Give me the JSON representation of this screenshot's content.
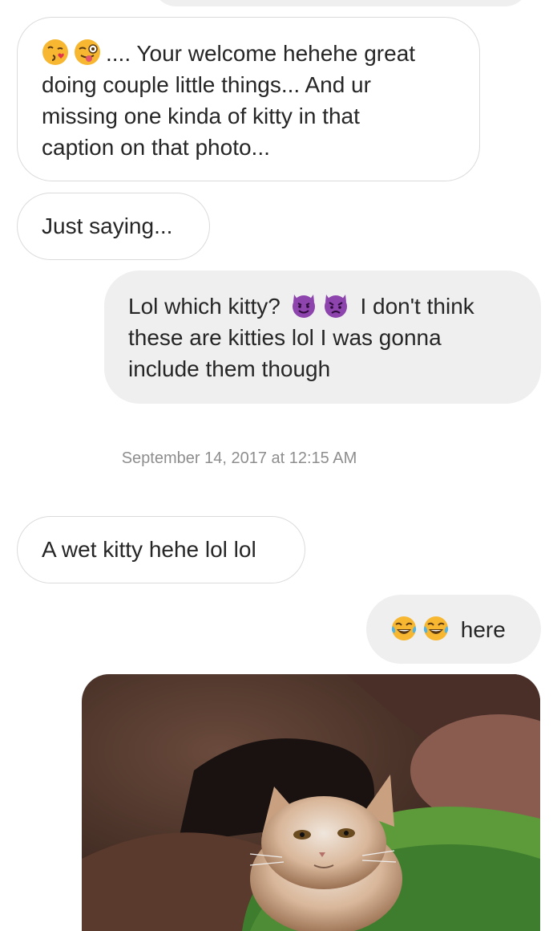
{
  "messages": {
    "msg1": {
      "emojis": [
        "kissing-wink-icon",
        "winking-tongue-icon"
      ],
      "line1": ".... Your welcome hehehe great",
      "line2": "doing couple little things... And ur",
      "line3": "missing one kinda of kitty in that",
      "line4": "caption on that photo..."
    },
    "msg2": {
      "text": "Just saying..."
    },
    "msg3": {
      "line1a": "Lol which kitty?",
      "emojis": [
        "smiling-devil-icon",
        "angry-devil-icon"
      ],
      "line1b": "I don't think",
      "line2": "these are kitties lol I was gonna",
      "line3": "include them though"
    },
    "timestamp": "September 14, 2017 at 12:15 AM",
    "msg4": {
      "text": "A wet kitty hehe lol lol"
    },
    "msg5": {
      "emojis": [
        "tears-of-joy-icon",
        "tears-of-joy-icon"
      ],
      "text": "here"
    },
    "photo": {
      "subject": "wet-kitten-photo"
    }
  },
  "colors": {
    "incoming_border": "#dbdbdb",
    "outgoing_bg": "#efefef",
    "timestamp": "#8e8e8e",
    "text": "#262626"
  }
}
